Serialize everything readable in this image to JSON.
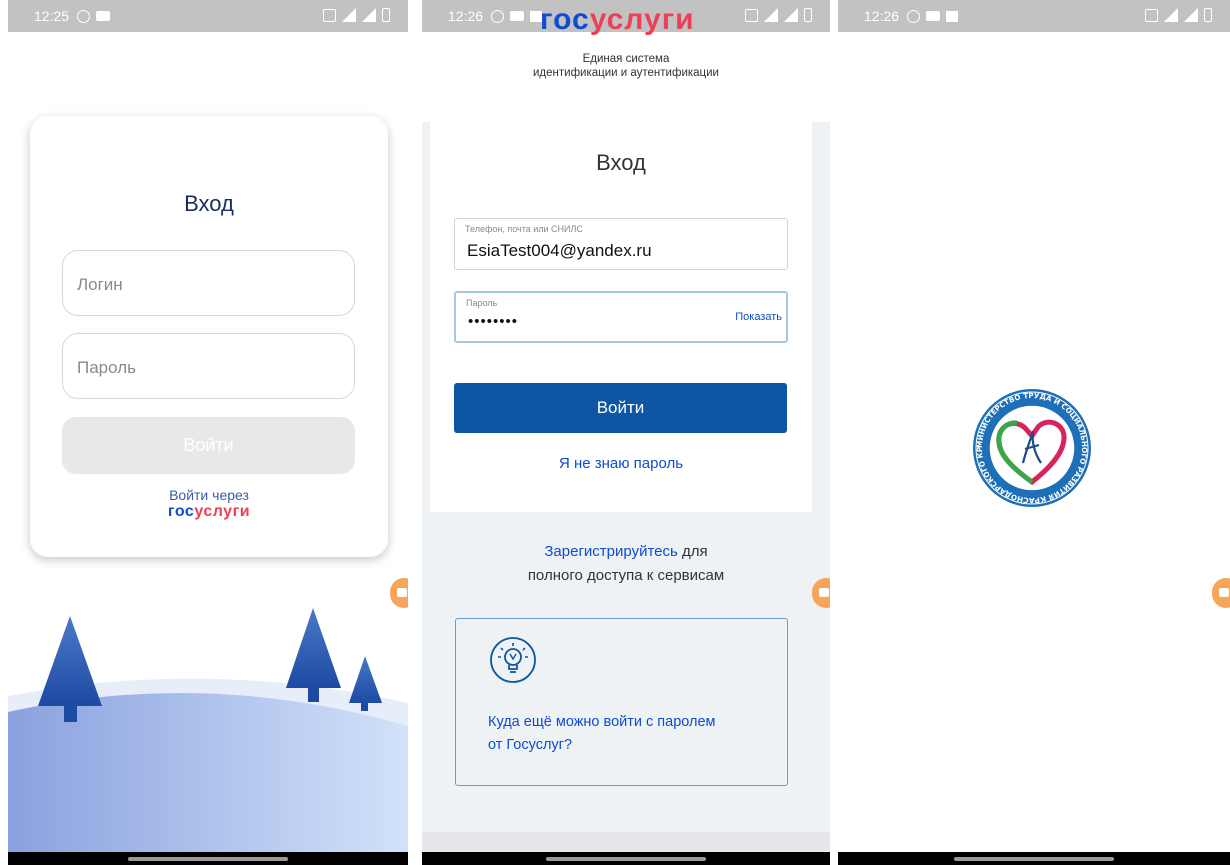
{
  "screen1": {
    "status_time": "12:25",
    "title": "Вход",
    "login_placeholder": "Логин",
    "password_placeholder": "Пароль",
    "submit_label": "Войти",
    "gosuslugi_caption": "Войти через",
    "gosuslugi_logo_part1": "гос",
    "gosuslugi_logo_part2": "услуги"
  },
  "screen2": {
    "status_time": "12:26",
    "logo_part1": "гос",
    "logo_part2": "услуги",
    "subtitle_line1": "Единая система",
    "subtitle_line2": "идентификации и аутентификации",
    "title": "Вход",
    "login_label": "Телефон, почта или СНИЛС",
    "login_value": "EsiaTest004@yandex.ru",
    "password_label": "Пароль",
    "password_value": "••••••••",
    "show_password": "Показать",
    "submit_label": "Войти",
    "forgot_password": "Я не знаю пароль",
    "register_link": "Зарегистрируйтесь",
    "register_text_1": " для",
    "register_text_2": "полного доступа к сервисам",
    "info_text": "Куда ещё можно войти с паролем от Госуслуг?",
    "icon": "lightbulb-icon"
  },
  "screen3": {
    "status_time": "12:26",
    "emblem": "ministry-emblem-icon",
    "emblem_text": "МИНИСТЕРСТВО ТРУДА И СОЦИАЛЬНОГО РАЗВИТИЯ КРАСНОДАРСКОГО КРАЯ"
  },
  "colors": {
    "gos_blue": "#0d4cd3",
    "gos_red": "#ee3f58",
    "primary_button": "#0d56a4",
    "record_button": "#f6a55a"
  }
}
